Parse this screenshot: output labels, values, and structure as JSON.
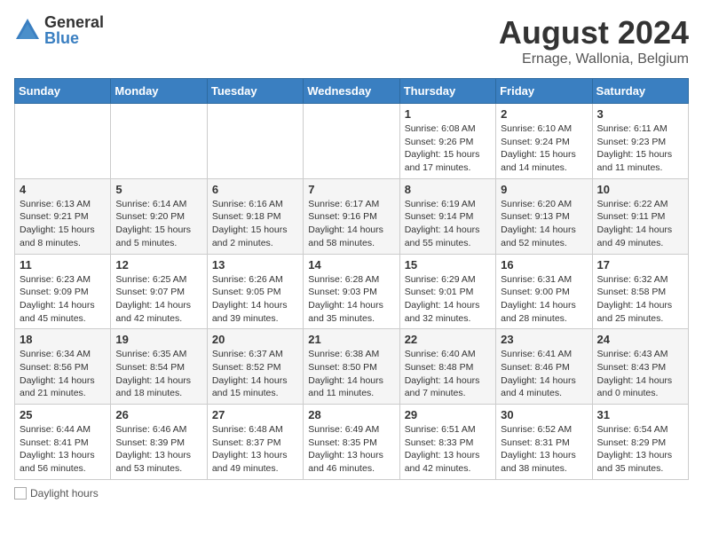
{
  "header": {
    "logo_general": "General",
    "logo_blue": "Blue",
    "month_title": "August 2024",
    "location": "Ernage, Wallonia, Belgium"
  },
  "weekdays": [
    "Sunday",
    "Monday",
    "Tuesday",
    "Wednesday",
    "Thursday",
    "Friday",
    "Saturday"
  ],
  "footer": {
    "daylight_label": "Daylight hours"
  },
  "weeks": [
    [
      {
        "day": "",
        "info": ""
      },
      {
        "day": "",
        "info": ""
      },
      {
        "day": "",
        "info": ""
      },
      {
        "day": "",
        "info": ""
      },
      {
        "day": "1",
        "info": "Sunrise: 6:08 AM\nSunset: 9:26 PM\nDaylight: 15 hours\nand 17 minutes."
      },
      {
        "day": "2",
        "info": "Sunrise: 6:10 AM\nSunset: 9:24 PM\nDaylight: 15 hours\nand 14 minutes."
      },
      {
        "day": "3",
        "info": "Sunrise: 6:11 AM\nSunset: 9:23 PM\nDaylight: 15 hours\nand 11 minutes."
      }
    ],
    [
      {
        "day": "4",
        "info": "Sunrise: 6:13 AM\nSunset: 9:21 PM\nDaylight: 15 hours\nand 8 minutes."
      },
      {
        "day": "5",
        "info": "Sunrise: 6:14 AM\nSunset: 9:20 PM\nDaylight: 15 hours\nand 5 minutes."
      },
      {
        "day": "6",
        "info": "Sunrise: 6:16 AM\nSunset: 9:18 PM\nDaylight: 15 hours\nand 2 minutes."
      },
      {
        "day": "7",
        "info": "Sunrise: 6:17 AM\nSunset: 9:16 PM\nDaylight: 14 hours\nand 58 minutes."
      },
      {
        "day": "8",
        "info": "Sunrise: 6:19 AM\nSunset: 9:14 PM\nDaylight: 14 hours\nand 55 minutes."
      },
      {
        "day": "9",
        "info": "Sunrise: 6:20 AM\nSunset: 9:13 PM\nDaylight: 14 hours\nand 52 minutes."
      },
      {
        "day": "10",
        "info": "Sunrise: 6:22 AM\nSunset: 9:11 PM\nDaylight: 14 hours\nand 49 minutes."
      }
    ],
    [
      {
        "day": "11",
        "info": "Sunrise: 6:23 AM\nSunset: 9:09 PM\nDaylight: 14 hours\nand 45 minutes."
      },
      {
        "day": "12",
        "info": "Sunrise: 6:25 AM\nSunset: 9:07 PM\nDaylight: 14 hours\nand 42 minutes."
      },
      {
        "day": "13",
        "info": "Sunrise: 6:26 AM\nSunset: 9:05 PM\nDaylight: 14 hours\nand 39 minutes."
      },
      {
        "day": "14",
        "info": "Sunrise: 6:28 AM\nSunset: 9:03 PM\nDaylight: 14 hours\nand 35 minutes."
      },
      {
        "day": "15",
        "info": "Sunrise: 6:29 AM\nSunset: 9:01 PM\nDaylight: 14 hours\nand 32 minutes."
      },
      {
        "day": "16",
        "info": "Sunrise: 6:31 AM\nSunset: 9:00 PM\nDaylight: 14 hours\nand 28 minutes."
      },
      {
        "day": "17",
        "info": "Sunrise: 6:32 AM\nSunset: 8:58 PM\nDaylight: 14 hours\nand 25 minutes."
      }
    ],
    [
      {
        "day": "18",
        "info": "Sunrise: 6:34 AM\nSunset: 8:56 PM\nDaylight: 14 hours\nand 21 minutes."
      },
      {
        "day": "19",
        "info": "Sunrise: 6:35 AM\nSunset: 8:54 PM\nDaylight: 14 hours\nand 18 minutes."
      },
      {
        "day": "20",
        "info": "Sunrise: 6:37 AM\nSunset: 8:52 PM\nDaylight: 14 hours\nand 15 minutes."
      },
      {
        "day": "21",
        "info": "Sunrise: 6:38 AM\nSunset: 8:50 PM\nDaylight: 14 hours\nand 11 minutes."
      },
      {
        "day": "22",
        "info": "Sunrise: 6:40 AM\nSunset: 8:48 PM\nDaylight: 14 hours\nand 7 minutes."
      },
      {
        "day": "23",
        "info": "Sunrise: 6:41 AM\nSunset: 8:46 PM\nDaylight: 14 hours\nand 4 minutes."
      },
      {
        "day": "24",
        "info": "Sunrise: 6:43 AM\nSunset: 8:43 PM\nDaylight: 14 hours\nand 0 minutes."
      }
    ],
    [
      {
        "day": "25",
        "info": "Sunrise: 6:44 AM\nSunset: 8:41 PM\nDaylight: 13 hours\nand 56 minutes."
      },
      {
        "day": "26",
        "info": "Sunrise: 6:46 AM\nSunset: 8:39 PM\nDaylight: 13 hours\nand 53 minutes."
      },
      {
        "day": "27",
        "info": "Sunrise: 6:48 AM\nSunset: 8:37 PM\nDaylight: 13 hours\nand 49 minutes."
      },
      {
        "day": "28",
        "info": "Sunrise: 6:49 AM\nSunset: 8:35 PM\nDaylight: 13 hours\nand 46 minutes."
      },
      {
        "day": "29",
        "info": "Sunrise: 6:51 AM\nSunset: 8:33 PM\nDaylight: 13 hours\nand 42 minutes."
      },
      {
        "day": "30",
        "info": "Sunrise: 6:52 AM\nSunset: 8:31 PM\nDaylight: 13 hours\nand 38 minutes."
      },
      {
        "day": "31",
        "info": "Sunrise: 6:54 AM\nSunset: 8:29 PM\nDaylight: 13 hours\nand 35 minutes."
      }
    ]
  ]
}
